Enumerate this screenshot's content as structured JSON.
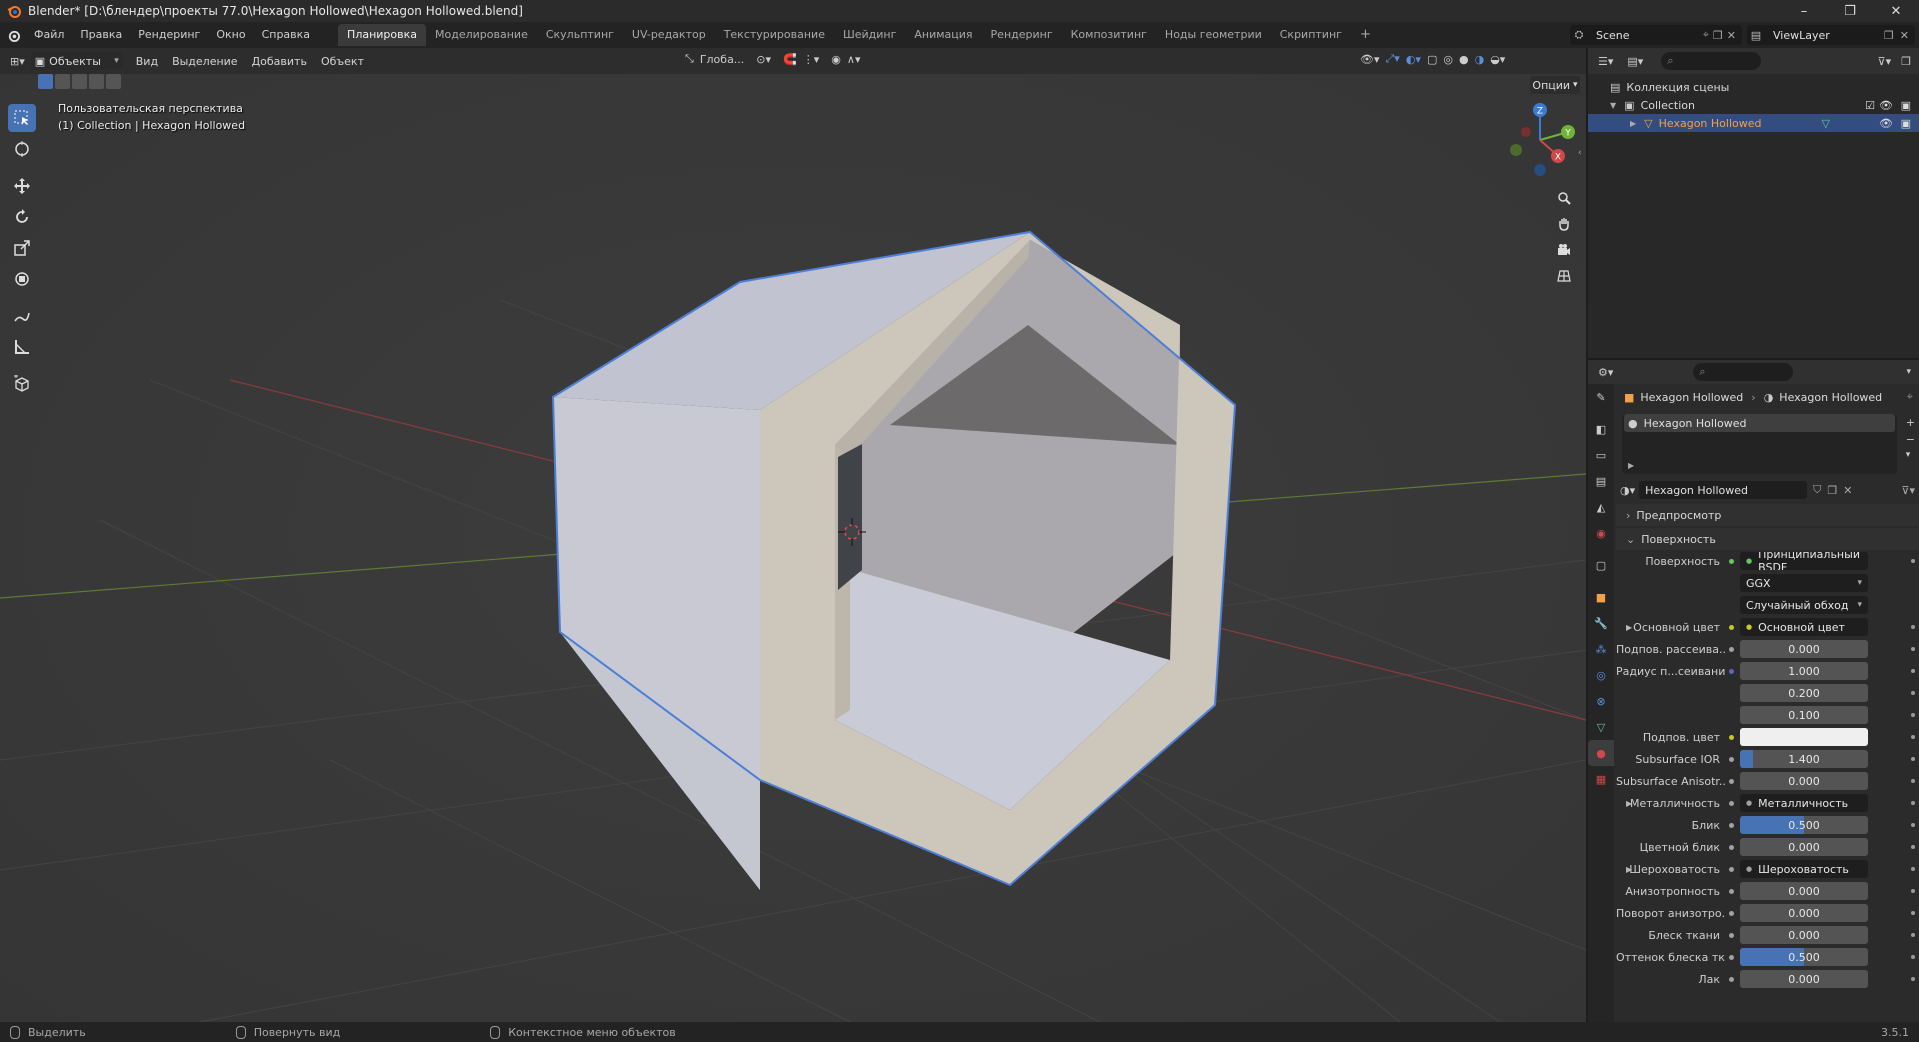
{
  "window": {
    "title": "Blender* [D:\\блендер\\проекты 77.0\\Hexagon Hollowed\\Hexagon Hollowed.blend]",
    "minimize": "–",
    "maximize": "❐",
    "close": "✕"
  },
  "menu": {
    "items": [
      "Файл",
      "Правка",
      "Рендеринг",
      "Окно",
      "Справка"
    ]
  },
  "workspaces": {
    "tabs": [
      "Планировка",
      "Моделирование",
      "Скульптинг",
      "UV-редактор",
      "Текстурирование",
      "Шейдинг",
      "Анимация",
      "Рендеринг",
      "Композитинг",
      "Ноды геометрии",
      "Скриптинг"
    ],
    "active": "Планировка",
    "add": "+"
  },
  "scene": {
    "name": "Scene",
    "view_layer": "ViewLayer"
  },
  "viewport": {
    "mode": "Объекты",
    "menus": [
      "Вид",
      "Выделение",
      "Добавить",
      "Объект"
    ],
    "orientation": "Глоба...",
    "options": "Опции",
    "overlay_line1": "Пользовательская перспектива",
    "overlay_line2": "(1) Collection | Hexagon Hollowed",
    "gizmo": {
      "z": "Z",
      "y": "Y",
      "x": "X"
    }
  },
  "outliner": {
    "root": "Коллекция сцены",
    "collection": "Collection",
    "object": "Hexagon Hollowed"
  },
  "properties": {
    "object_name": "Hexagon Hollowed",
    "mesh_name": "Hexagon Hollowed",
    "slot": "Hexagon Hollowed",
    "material": "Hexagon Hollowed",
    "panels": {
      "preview": "Предпросмотр",
      "surface": "Поверхность"
    },
    "rows": [
      {
        "label": "Поверхность",
        "type": "link",
        "value": "Принципиальный BSDF",
        "socket": "green"
      },
      {
        "label": "",
        "type": "dropdown",
        "value": "GGX"
      },
      {
        "label": "",
        "type": "dropdown",
        "value": "Случайный обход"
      },
      {
        "label": "Основной цвет",
        "type": "link",
        "value": "Основной цвет",
        "socket": "yellow",
        "expand": true
      },
      {
        "label": "Подпов. рассеива...",
        "type": "number",
        "value": "0.000",
        "socket": "gray"
      },
      {
        "label": "Радиус п...сеивания",
        "type": "number",
        "value": "1.000",
        "socket": "purple"
      },
      {
        "label": "",
        "type": "number",
        "value": "0.200"
      },
      {
        "label": "",
        "type": "number",
        "value": "0.100"
      },
      {
        "label": "Подпов. цвет",
        "type": "color",
        "value": "",
        "socket": "yellow"
      },
      {
        "label": "Subsurface IOR",
        "type": "number",
        "value": "1.400",
        "socket": "gray",
        "fill": 0.1
      },
      {
        "label": "Subsurface Anisotr...",
        "type": "number",
        "value": "0.000",
        "socket": "gray"
      },
      {
        "label": "Металличность",
        "type": "link",
        "value": "Металличность",
        "socket": "gray",
        "expand": true
      },
      {
        "label": "Блик",
        "type": "number",
        "value": "0.500",
        "socket": "gray",
        "fill": 0.5
      },
      {
        "label": "Цветной блик",
        "type": "number",
        "value": "0.000",
        "socket": "gray"
      },
      {
        "label": "Шероховатость",
        "type": "link",
        "value": "Шероховатость",
        "socket": "gray",
        "expand": true
      },
      {
        "label": "Анизотропность",
        "type": "number",
        "value": "0.000",
        "socket": "gray"
      },
      {
        "label": "Поворот анизотро...",
        "type": "number",
        "value": "0.000",
        "socket": "gray"
      },
      {
        "label": "Блеск ткани",
        "type": "number",
        "value": "0.000",
        "socket": "gray"
      },
      {
        "label": "Оттенок блеска тк...",
        "type": "number",
        "value": "0.500",
        "socket": "gray",
        "fill": 0.5
      },
      {
        "label": "Лак",
        "type": "number",
        "value": "0.000",
        "socket": "gray"
      }
    ]
  },
  "statusbar": {
    "select": "Выделить",
    "rotate": "Повернуть вид",
    "context": "Контекстное меню объектов",
    "version": "3.5.1"
  }
}
